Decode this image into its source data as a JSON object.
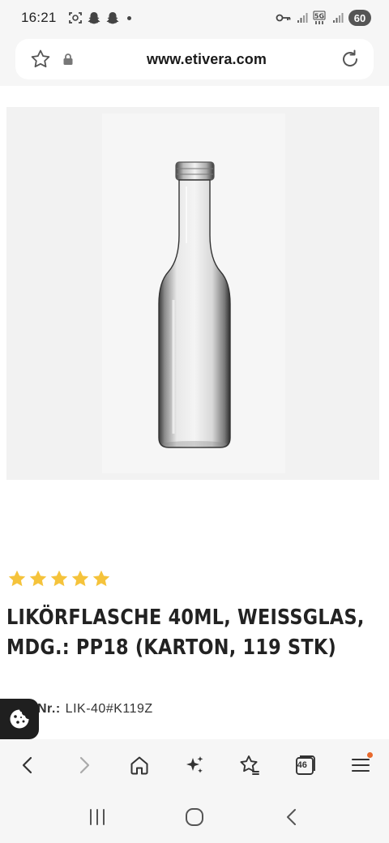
{
  "status_bar": {
    "time": "16:21",
    "left_icons": [
      "screenshot-icon",
      "snapchat-icon",
      "snapchat-icon",
      "dot"
    ],
    "right_icons": [
      "key-icon",
      "signal-icon",
      "5g-icon",
      "signal-icon"
    ],
    "battery": "60"
  },
  "browser": {
    "url": "www.etivera.com",
    "icons": [
      "star-outline-icon",
      "lock-icon",
      "reload-icon"
    ]
  },
  "product": {
    "image_alt": "Glass liqueur bottle",
    "rating_stars": 5,
    "rating_color": "#f5c33b",
    "title_line1": "LIKÖRFLASCHE 40ML, WEISSGLAS,",
    "title_line2": "MDG.: PP18 (KARTON, 119 STK)",
    "article_label": "Nr.:",
    "article_value": "LIK-40#K119Z"
  },
  "toolbar": {
    "tab_count": "46",
    "notification_color": "#e8692c",
    "buttons": [
      "back-icon",
      "forward-icon",
      "home-icon",
      "ai-sparkle-icon",
      "bookmarks-icon",
      "tabs-icon",
      "menu-icon"
    ]
  },
  "nav": {
    "buttons": [
      "recent-apps-icon",
      "home-circle-icon",
      "back-chevron-icon"
    ]
  }
}
